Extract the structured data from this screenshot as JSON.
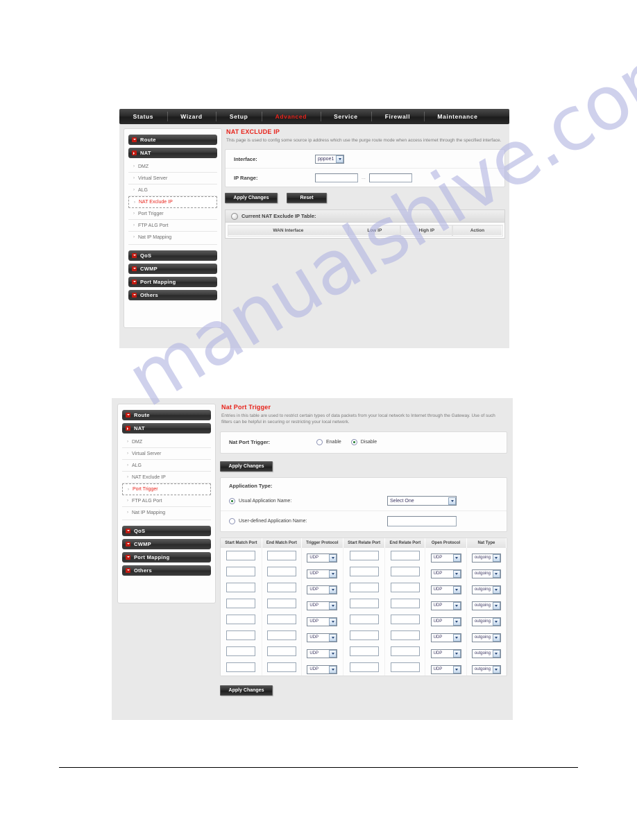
{
  "watermark": {
    "text": "manualshive.com",
    "color": "#b3b6e2"
  },
  "nav": {
    "items": [
      {
        "label": "Status",
        "active": false
      },
      {
        "label": "Wizard",
        "active": false
      },
      {
        "label": "Setup",
        "active": false
      },
      {
        "label": "Advanced",
        "active": true
      },
      {
        "label": "Service",
        "active": false
      },
      {
        "label": "Firewall",
        "active": false
      },
      {
        "label": "Maintenance",
        "active": false
      }
    ],
    "active_color": "#e8231b"
  },
  "sidebar": {
    "groups_top": [
      {
        "label": "Route",
        "icon": "chevron-down-icon"
      },
      {
        "label": "NAT",
        "icon": "chevron-right-icon"
      }
    ],
    "sub_items": [
      {
        "label": "DMZ"
      },
      {
        "label": "Virtual Server"
      },
      {
        "label": "ALG"
      },
      {
        "label": "NAT Exclude IP"
      },
      {
        "label": "Port Trigger"
      },
      {
        "label": "FTP ALG Port"
      },
      {
        "label": "Nat IP Mapping"
      }
    ],
    "groups_bottom": [
      {
        "label": "QoS",
        "icon": "chevron-down-icon"
      },
      {
        "label": "CWMP",
        "icon": "chevron-down-icon"
      },
      {
        "label": "Port Mapping",
        "icon": "chevron-down-icon"
      },
      {
        "label": "Others",
        "icon": "chevron-down-icon"
      }
    ],
    "selected_panel1": "NAT Exclude IP",
    "selected_panel2": "Port Trigger"
  },
  "panel1": {
    "title": "NAT EXCLUDE IP",
    "description": "This page is used to config some source ip address which use the purge route mode when access internet through the specified interface.",
    "interface_label": "Interface:",
    "interface_value": "pppoe1",
    "ip_range_label": "IP Range:",
    "ip_range_start": "",
    "ip_range_end": "",
    "ip_range_separator": "...",
    "apply_label": "Apply Changes",
    "reset_label": "Reset",
    "table_caption": "Current NAT Exclude IP Table:",
    "table_headers": [
      "WAN Interface",
      "Low IP",
      "High IP",
      "Action"
    ],
    "table_rows": []
  },
  "panel2": {
    "title": "Nat Port Trigger",
    "description": "Entries in this table are used to restrict certain types of data packets from your local network to Internet through the Gateway. Use of such filters can be helpful in securing or restricting your local network.",
    "trigger_label": "Nat Port Trigger:",
    "radio_enable": "Enable",
    "radio_disable": "Disable",
    "radio_selected": "Disable",
    "apply_label_top": "Apply Changes",
    "apply_label_bottom": "Apply Changes",
    "app_type_label": "Application Type:",
    "usual_app_label": "Usual Application Name:",
    "usual_app_value": "Select One",
    "usual_app_selected": true,
    "userdef_app_label": "User-defined Application Name:",
    "userdef_app_value": "",
    "userdef_app_selected": false,
    "table_headers": [
      "Start Match Port",
      "End Match Port",
      "Trigger Protocol",
      "Start Relate Port",
      "End Relate Port",
      "Open Protocol",
      "Nat Type"
    ],
    "row_count": 8,
    "row_defaults": {
      "start_match_port": "",
      "end_match_port": "",
      "trigger_protocol": "UDP",
      "start_relate_port": "",
      "end_relate_port": "",
      "open_protocol": "UDP",
      "nat_type": "outgoing"
    }
  }
}
